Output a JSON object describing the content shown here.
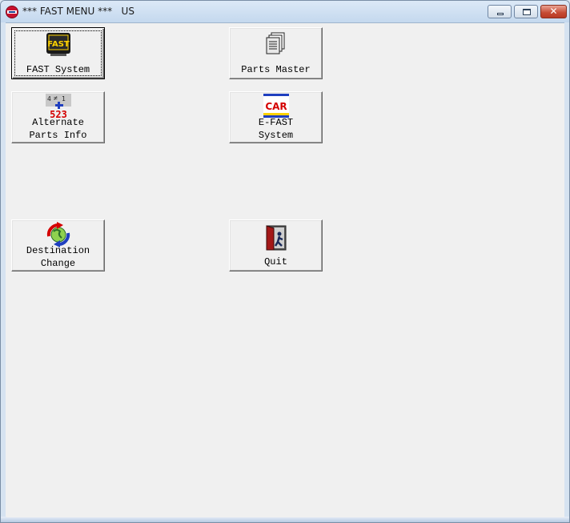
{
  "window": {
    "title": "*** FAST MENU ***   US",
    "controls": {
      "minimize": "minimize",
      "maximize": "maximize",
      "close": "✕"
    }
  },
  "menu": {
    "buttons": [
      {
        "id": "fast-system",
        "label": "FAST System",
        "icon": "fast-logo-icon",
        "icon_text": "FAST"
      },
      {
        "id": "parts-master",
        "label": "Parts Master",
        "icon": "documents-stack-icon"
      },
      {
        "id": "alternate-parts-info",
        "label": "Alternate\nParts Info",
        "icon": "alternate-parts-icon",
        "icon_text": "523"
      },
      {
        "id": "e-fast-system",
        "label": "E-FAST\nSystem",
        "icon": "car-icon",
        "icon_text": "CAR"
      },
      {
        "id": "destination-change",
        "label": "Destination\nChange",
        "icon": "globe-arrows-icon"
      },
      {
        "id": "quit",
        "label": "Quit",
        "icon": "exit-door-icon"
      }
    ]
  },
  "colors": {
    "client_bg": "#f0f0f0",
    "fast_icon_bg": "#1a1a1a",
    "fast_icon_text": "#ffd200",
    "car_icon_text": "#d40000",
    "car_icon_band": "#1f3fbf"
  }
}
